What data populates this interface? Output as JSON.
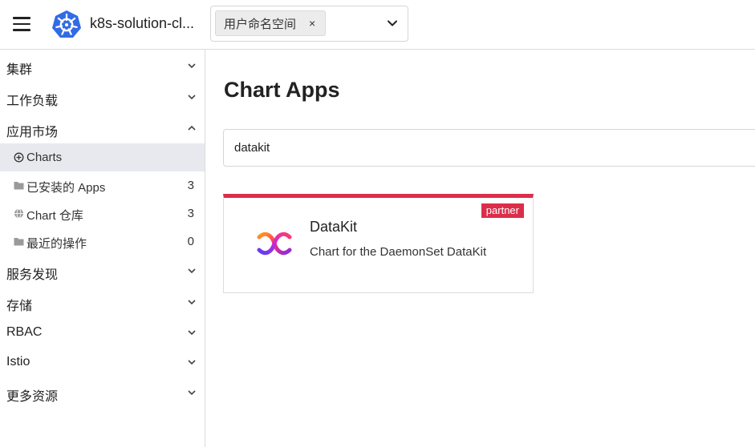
{
  "header": {
    "menu_icon": "hamburger-menu-icon",
    "logo_icon": "kubernetes-logo-icon",
    "cluster_name": "k8s-solution-cl...",
    "namespace_select": {
      "selected": "用户命名空间",
      "remove_icon": "close-icon",
      "remove_glyph": "×",
      "caret_icon": "chevron-down-icon"
    }
  },
  "sidebar": {
    "groups": [
      {
        "label": "集群",
        "icon": "chevron-down-icon"
      },
      {
        "label": "工作负载",
        "icon": "chevron-down-icon"
      },
      {
        "label": "应用市场",
        "icon": "chevron-up-icon"
      },
      {
        "label": "服务发现",
        "icon": "chevron-down-icon"
      },
      {
        "label": "存储",
        "icon": "chevron-down-icon"
      },
      {
        "label": "RBAC",
        "icon": "chevron-down-icon"
      },
      {
        "label": "Istio",
        "icon": "chevron-down-icon"
      },
      {
        "label": "更多资源",
        "icon": "chevron-down-icon"
      }
    ],
    "app_market_items": [
      {
        "label": "Charts",
        "icon": "compass-icon",
        "count": "",
        "active": true
      },
      {
        "label": "已安装的 Apps",
        "icon": "folder-icon",
        "count": "3",
        "active": false
      },
      {
        "label": "Chart 仓库",
        "icon": "globe-icon",
        "count": "3",
        "active": false
      },
      {
        "label": "最近的操作",
        "icon": "folder-icon",
        "count": "0",
        "active": false
      }
    ]
  },
  "main": {
    "title": "Chart Apps",
    "search": {
      "value": "datakit",
      "placeholder": ""
    },
    "cards": [
      {
        "name": "DataKit",
        "description": "Chart for the DaemonSet DataKit",
        "badge": "partner",
        "logo_icon": "datakit-logo-icon"
      }
    ]
  },
  "colors": {
    "accent_red": "#dc2e4a",
    "active_bg": "#e8e9ee",
    "k8s_blue": "#326ce5",
    "border": "#dcdcdc"
  }
}
